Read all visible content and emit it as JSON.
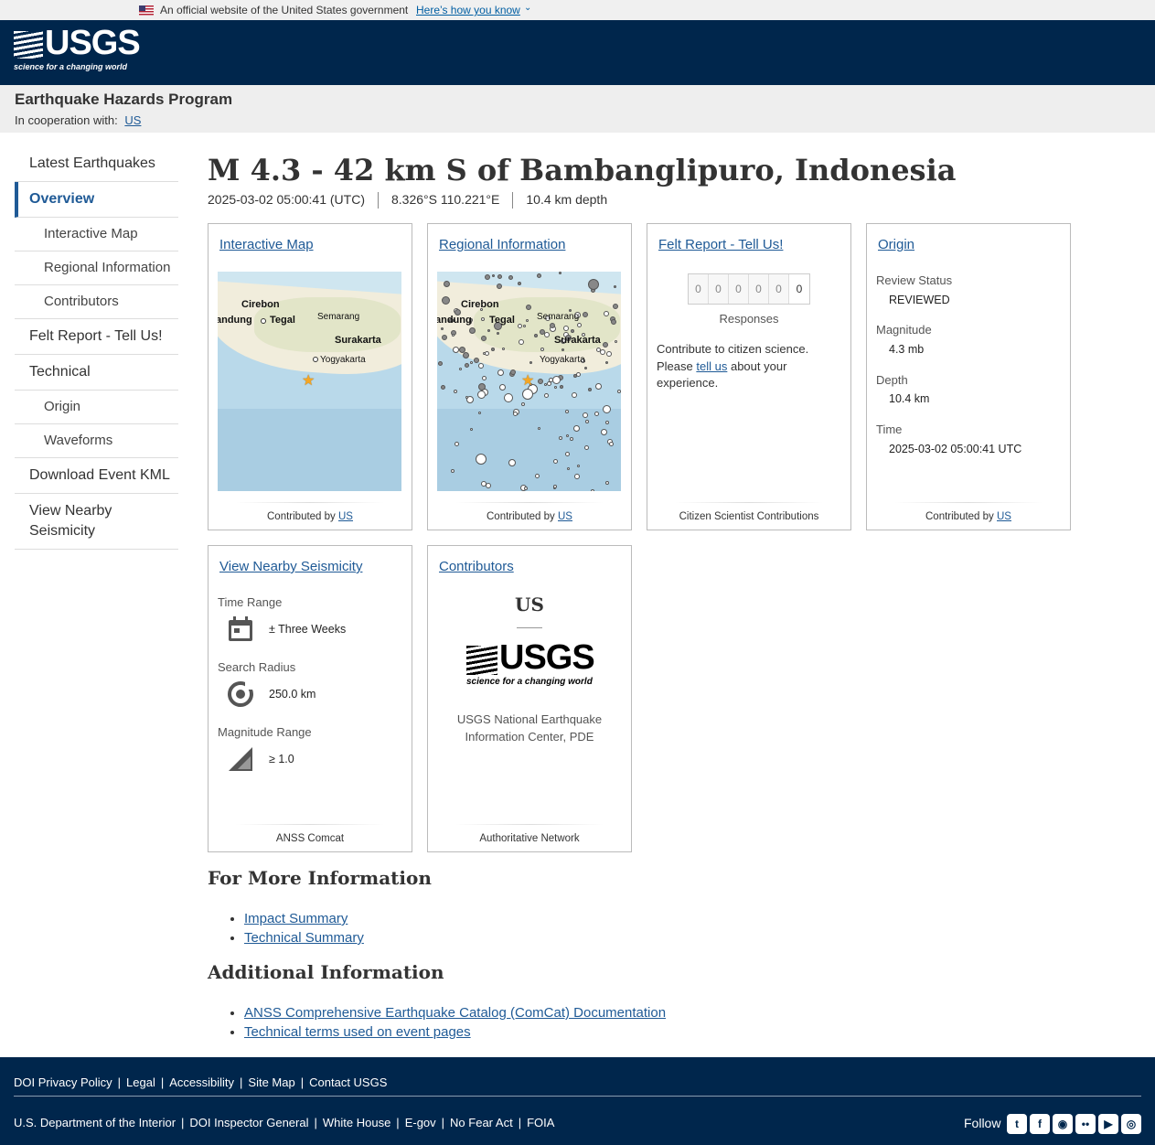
{
  "gov_banner": {
    "text": "An official website of the United States government",
    "link": "Here’s how you know"
  },
  "header": {
    "logo_text": "USGS",
    "logo_tagline": "science for a changing world"
  },
  "program": {
    "title": "Earthquake Hazards Program",
    "coop_label": "In cooperation with:",
    "coop_link": "US"
  },
  "nav": [
    {
      "label": "Latest Earthquakes"
    },
    {
      "label": "Overview"
    },
    {
      "label": "Interactive Map"
    },
    {
      "label": "Regional Information"
    },
    {
      "label": "Contributors"
    },
    {
      "label": "Felt Report - Tell Us!"
    },
    {
      "label": "Technical"
    },
    {
      "label": "Origin"
    },
    {
      "label": "Waveforms"
    },
    {
      "label": "Download Event KML"
    },
    {
      "label": "View Nearby Seismicity"
    }
  ],
  "event": {
    "title": "M 4.3 - 42 km S of Bambanglipuro, Indonesia",
    "time": "2025-03-02 05:00:41 (UTC)",
    "location": "8.326°S 110.221°E",
    "depth": "10.4 km depth"
  },
  "cards": {
    "interactive_map": {
      "title": "Interactive Map",
      "footer_prefix": "Contributed by",
      "footer_link": "US"
    },
    "regional": {
      "title": "Regional Information",
      "footer_prefix": "Contributed by",
      "footer_link": "US"
    },
    "map_labels": {
      "cirebon": "Cirebon",
      "bandung": "andung",
      "tegal": "Tegal",
      "semarang": "Semarang",
      "surakarta": "Surakarta",
      "yogyakarta": "Yogyakarta"
    },
    "felt": {
      "title": "Felt Report - Tell Us!",
      "digits": [
        "0",
        "0",
        "0",
        "0",
        "0",
        "0"
      ],
      "responses_label": "Responses",
      "text_before": "Contribute to citizen science. Please",
      "link": "tell us",
      "text_after": "about your experience.",
      "footer": "Citizen Scientist Contributions"
    },
    "origin": {
      "title": "Origin",
      "review_label": "Review Status",
      "review_value": "REVIEWED",
      "magnitude_label": "Magnitude",
      "magnitude_value": "4.3 mb",
      "depth_label": "Depth",
      "depth_value": "10.4 km",
      "time_label": "Time",
      "time_value": "2025-03-02 05:00:41 UTC",
      "footer_prefix": "Contributed by",
      "footer_link": "US"
    },
    "seismicity": {
      "title": "View Nearby Seismicity",
      "time_label": "Time Range",
      "time_value": "± Three Weeks",
      "radius_label": "Search Radius",
      "radius_value": "250.0 km",
      "mag_label": "Magnitude Range",
      "mag_value": "≥ 1.0",
      "footer": "ANSS Comcat"
    },
    "contributors": {
      "title": "Contributors",
      "code": "US",
      "logo_text": "USGS",
      "logo_tagline": "science for a changing world",
      "name": "USGS National Earthquake Information Center, PDE",
      "footer": "Authoritative Network"
    }
  },
  "more_info": {
    "heading": "For More Information",
    "links": [
      "Impact Summary",
      "Technical Summary"
    ]
  },
  "additional": {
    "heading": "Additional Information",
    "links": [
      "ANSS Comprehensive Earthquake Catalog (ComCat) Documentation",
      "Technical terms used on event pages"
    ]
  },
  "footer": {
    "row1": [
      "DOI Privacy Policy",
      "Legal",
      "Accessibility",
      "Site Map",
      "Contact USGS"
    ],
    "row2": [
      "U.S. Department of the Interior",
      "DOI Inspector General",
      "White House",
      "E-gov",
      "No Fear Act",
      "FOIA"
    ],
    "follow": "Follow",
    "social_icons": [
      "twitter-icon",
      "facebook-icon",
      "github-icon",
      "flickr-icon",
      "youtube-icon",
      "instagram-icon"
    ]
  },
  "colors": {
    "header_bg": "#00264c",
    "link": "#1f5a96",
    "star": "#f5a623"
  }
}
